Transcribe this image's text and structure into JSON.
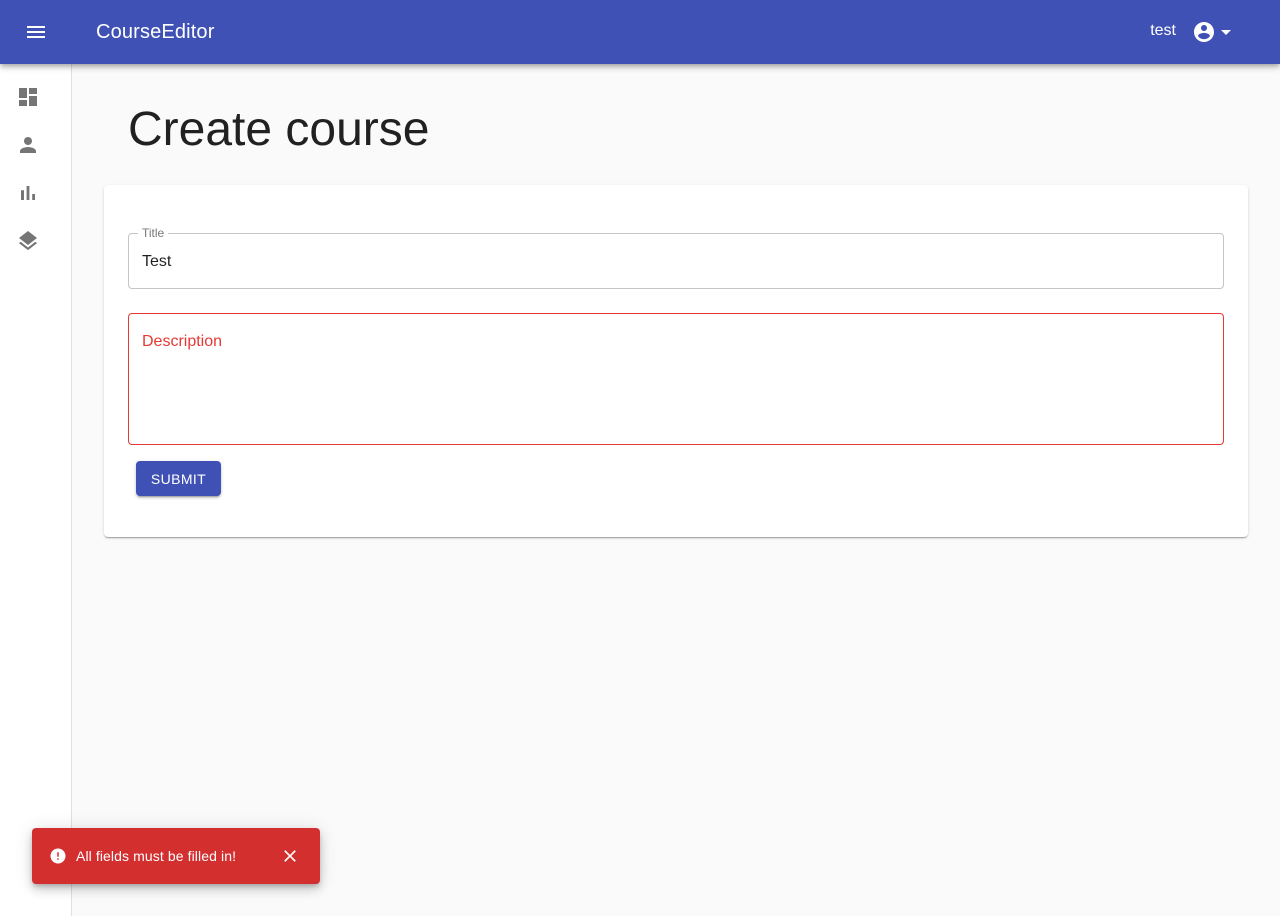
{
  "appbar": {
    "title": "CourseEditor",
    "username": "test",
    "menu_icon": "menu-icon",
    "account_icon": "account-circle-icon",
    "dropdown_icon": "arrow-drop-down-icon",
    "color": "#3f51b5"
  },
  "sidebar": {
    "items": [
      {
        "icon": "dashboard-icon"
      },
      {
        "icon": "person-icon"
      },
      {
        "icon": "bar-chart-icon"
      },
      {
        "icon": "layers-icon"
      }
    ]
  },
  "page": {
    "title": "Create course"
  },
  "form": {
    "title_label": "Title",
    "title_value": "Test",
    "description_placeholder": "Description",
    "description_value": "",
    "submit_label": "SUBMIT",
    "error_color": "#e53935"
  },
  "snackbar": {
    "message": "All fields must be filled in!",
    "icon": "error-icon",
    "close_icon": "close-icon",
    "color": "#d32f2f"
  }
}
